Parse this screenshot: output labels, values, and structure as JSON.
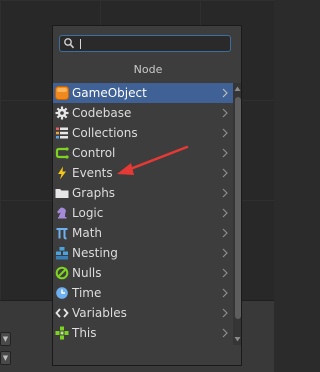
{
  "search": {
    "value": "",
    "placeholder": ""
  },
  "panel": {
    "title": "Node"
  },
  "items": [
    {
      "label": "GameObject",
      "icon": "gameobject-icon",
      "selected": true
    },
    {
      "label": "Codebase",
      "icon": "gear-icon"
    },
    {
      "label": "Collections",
      "icon": "list-icon"
    },
    {
      "label": "Control",
      "icon": "control-flow-icon"
    },
    {
      "label": "Events",
      "icon": "lightning-icon"
    },
    {
      "label": "Graphs",
      "icon": "folder-icon"
    },
    {
      "label": "Logic",
      "icon": "chess-knight-icon"
    },
    {
      "label": "Math",
      "icon": "pi-icon"
    },
    {
      "label": "Nesting",
      "icon": "nesting-icon"
    },
    {
      "label": "Nulls",
      "icon": "null-icon"
    },
    {
      "label": "Time",
      "icon": "clock-icon"
    },
    {
      "label": "Variables",
      "icon": "code-brackets-icon"
    },
    {
      "label": "This",
      "icon": "this-icon"
    }
  ],
  "colors": {
    "selection": "#3f6196",
    "annotation_arrow": "#e53935",
    "panel_bg": "#3d3d3d",
    "search_border": "#3e6f9c"
  }
}
